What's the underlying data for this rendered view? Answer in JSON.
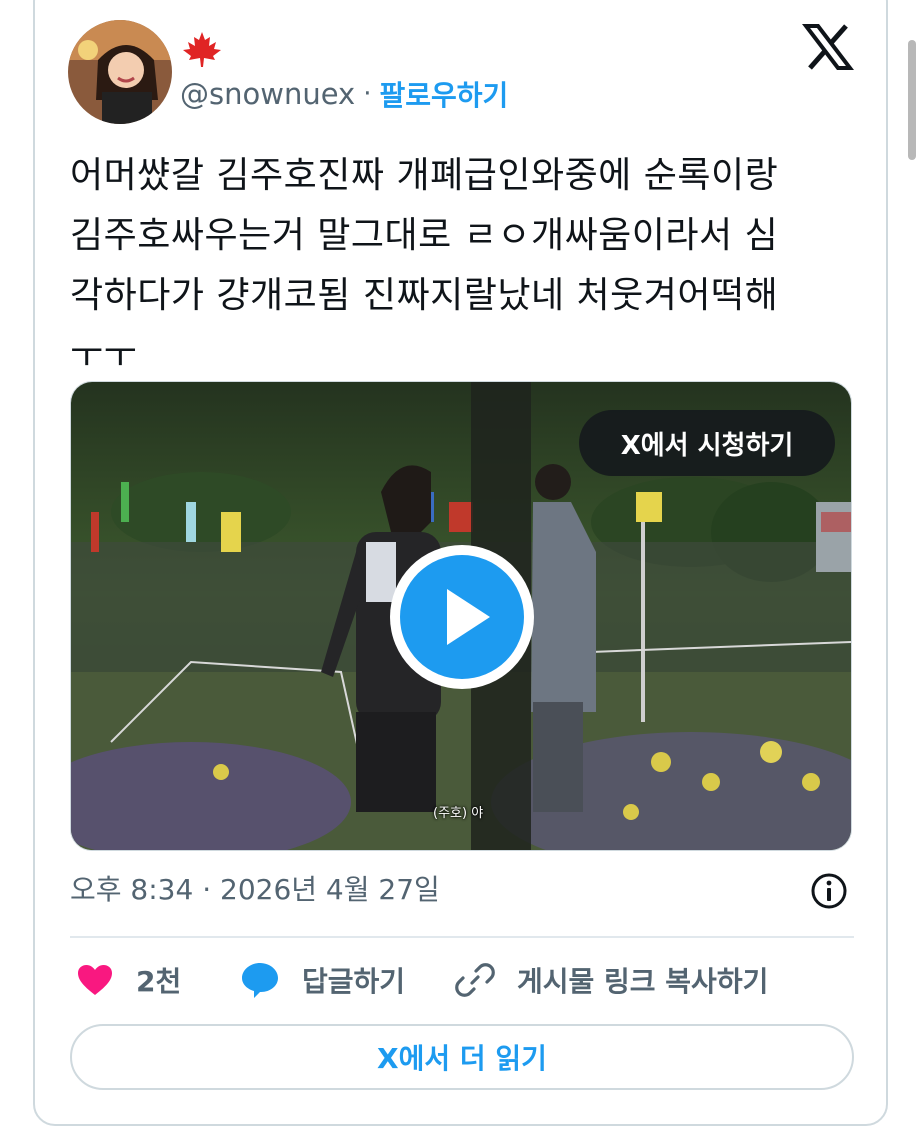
{
  "author": {
    "handle": "@snownuex",
    "separator": "·",
    "follow_label": "팔로우하기",
    "flag_icon": "maple-leaf-icon"
  },
  "brand": {
    "logo": "x-logo-icon"
  },
  "tweet": {
    "text": "어머썄갈 김주호진짜 개폐급인와중에 순록이랑\n김주호싸우는거 말그대로 ㄹㅇ개싸움이라서 심\n각하다가 걍개코됨 진짜지랄났네 처웃겨어떡해\nㅜㅜ"
  },
  "media": {
    "watch_label": "X에서 시청하기",
    "subtitle": "(주호) 야",
    "play_icon": "play-icon"
  },
  "meta": {
    "timestamp": "오후 8:34 · 2026년 4월 27일",
    "info_icon": "info-icon"
  },
  "actions": {
    "like_count": "2천",
    "reply_label": "답글하기",
    "copy_link_label": "게시물 링크 복사하기"
  },
  "read_more_label": "X에서 더 읽기",
  "colors": {
    "accent": "#1d9bf0",
    "like": "#f91880",
    "text": "#0f1419",
    "secondary": "#536471"
  }
}
